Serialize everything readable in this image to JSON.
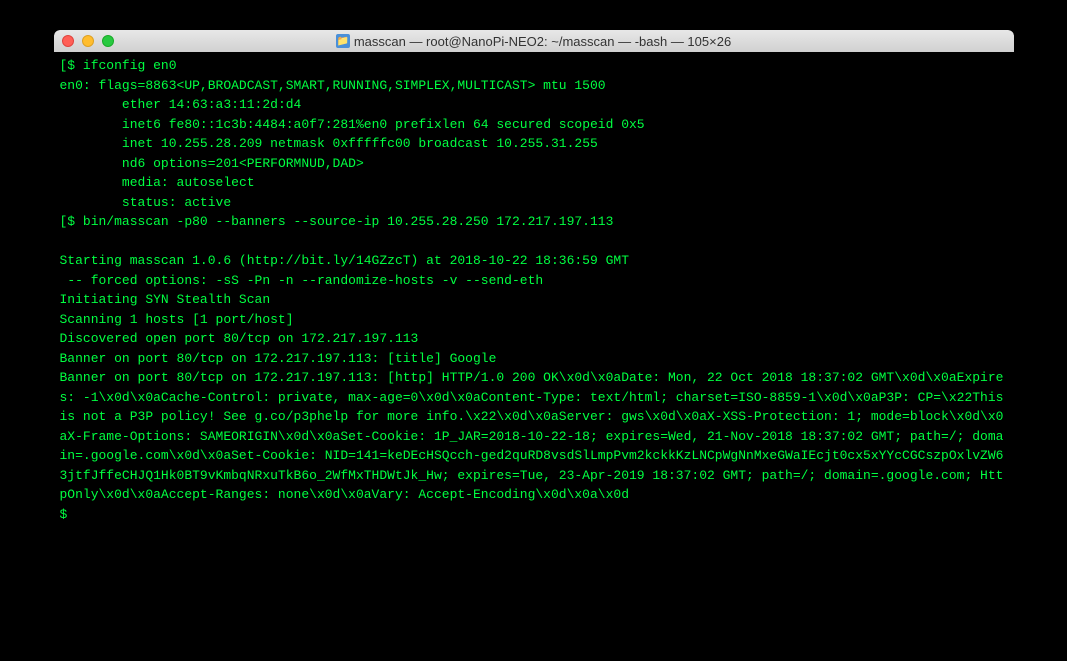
{
  "window": {
    "title": "masscan — root@NanoPi-NEO2: ~/masscan — -bash — 105×26",
    "icon_glyph": "📁"
  },
  "terminal": {
    "lines": [
      "[$ ifconfig en0",
      "en0: flags=8863<UP,BROADCAST,SMART,RUNNING,SIMPLEX,MULTICAST> mtu 1500",
      "        ether 14:63:a3:11:2d:d4",
      "        inet6 fe80::1c3b:4484:a0f7:281%en0 prefixlen 64 secured scopeid 0x5",
      "        inet 10.255.28.209 netmask 0xfffffc00 broadcast 10.255.31.255",
      "        nd6 options=201<PERFORMNUD,DAD>",
      "        media: autoselect",
      "        status: active",
      "[$ bin/masscan -p80 --banners --source-ip 10.255.28.250 172.217.197.113",
      "",
      "Starting masscan 1.0.6 (http://bit.ly/14GZzcT) at 2018-10-22 18:36:59 GMT",
      " -- forced options: -sS -Pn -n --randomize-hosts -v --send-eth",
      "Initiating SYN Stealth Scan",
      "Scanning 1 hosts [1 port/host]",
      "Discovered open port 80/tcp on 172.217.197.113",
      "Banner on port 80/tcp on 172.217.197.113: [title] Google",
      "Banner on port 80/tcp on 172.217.197.113: [http] HTTP/1.0 200 OK\\x0d\\x0aDate: Mon, 22 Oct 2018 18:37:02 GMT\\x0d\\x0aExpires: -1\\x0d\\x0aCache-Control: private, max-age=0\\x0d\\x0aContent-Type: text/html; charset=ISO-8859-1\\x0d\\x0aP3P: CP=\\x22This is not a P3P policy! See g.co/p3phelp for more info.\\x22\\x0d\\x0aServer: gws\\x0d\\x0aX-XSS-Protection: 1; mode=block\\x0d\\x0aX-Frame-Options: SAMEORIGIN\\x0d\\x0aSet-Cookie: 1P_JAR=2018-10-22-18; expires=Wed, 21-Nov-2018 18:37:02 GMT; path=/; domain=.google.com\\x0d\\x0aSet-Cookie: NID=141=keDEcHSQcch-ged2quRD8vsdSlLmpPvm2kckkKzLNCpWgNnMxeGWaIEcjt0cx5xYYcCGCszpOxlvZW63jtfJffeCHJQ1Hk0BT9vKmbqNRxuTkB6o_2WfMxTHDWtJk_Hw; expires=Tue, 23-Apr-2019 18:37:02 GMT; path=/; domain=.google.com; HttpOnly\\x0d\\x0aAccept-Ranges: none\\x0d\\x0aVary: Accept-Encoding\\x0d\\x0a\\x0d",
      "$"
    ]
  }
}
